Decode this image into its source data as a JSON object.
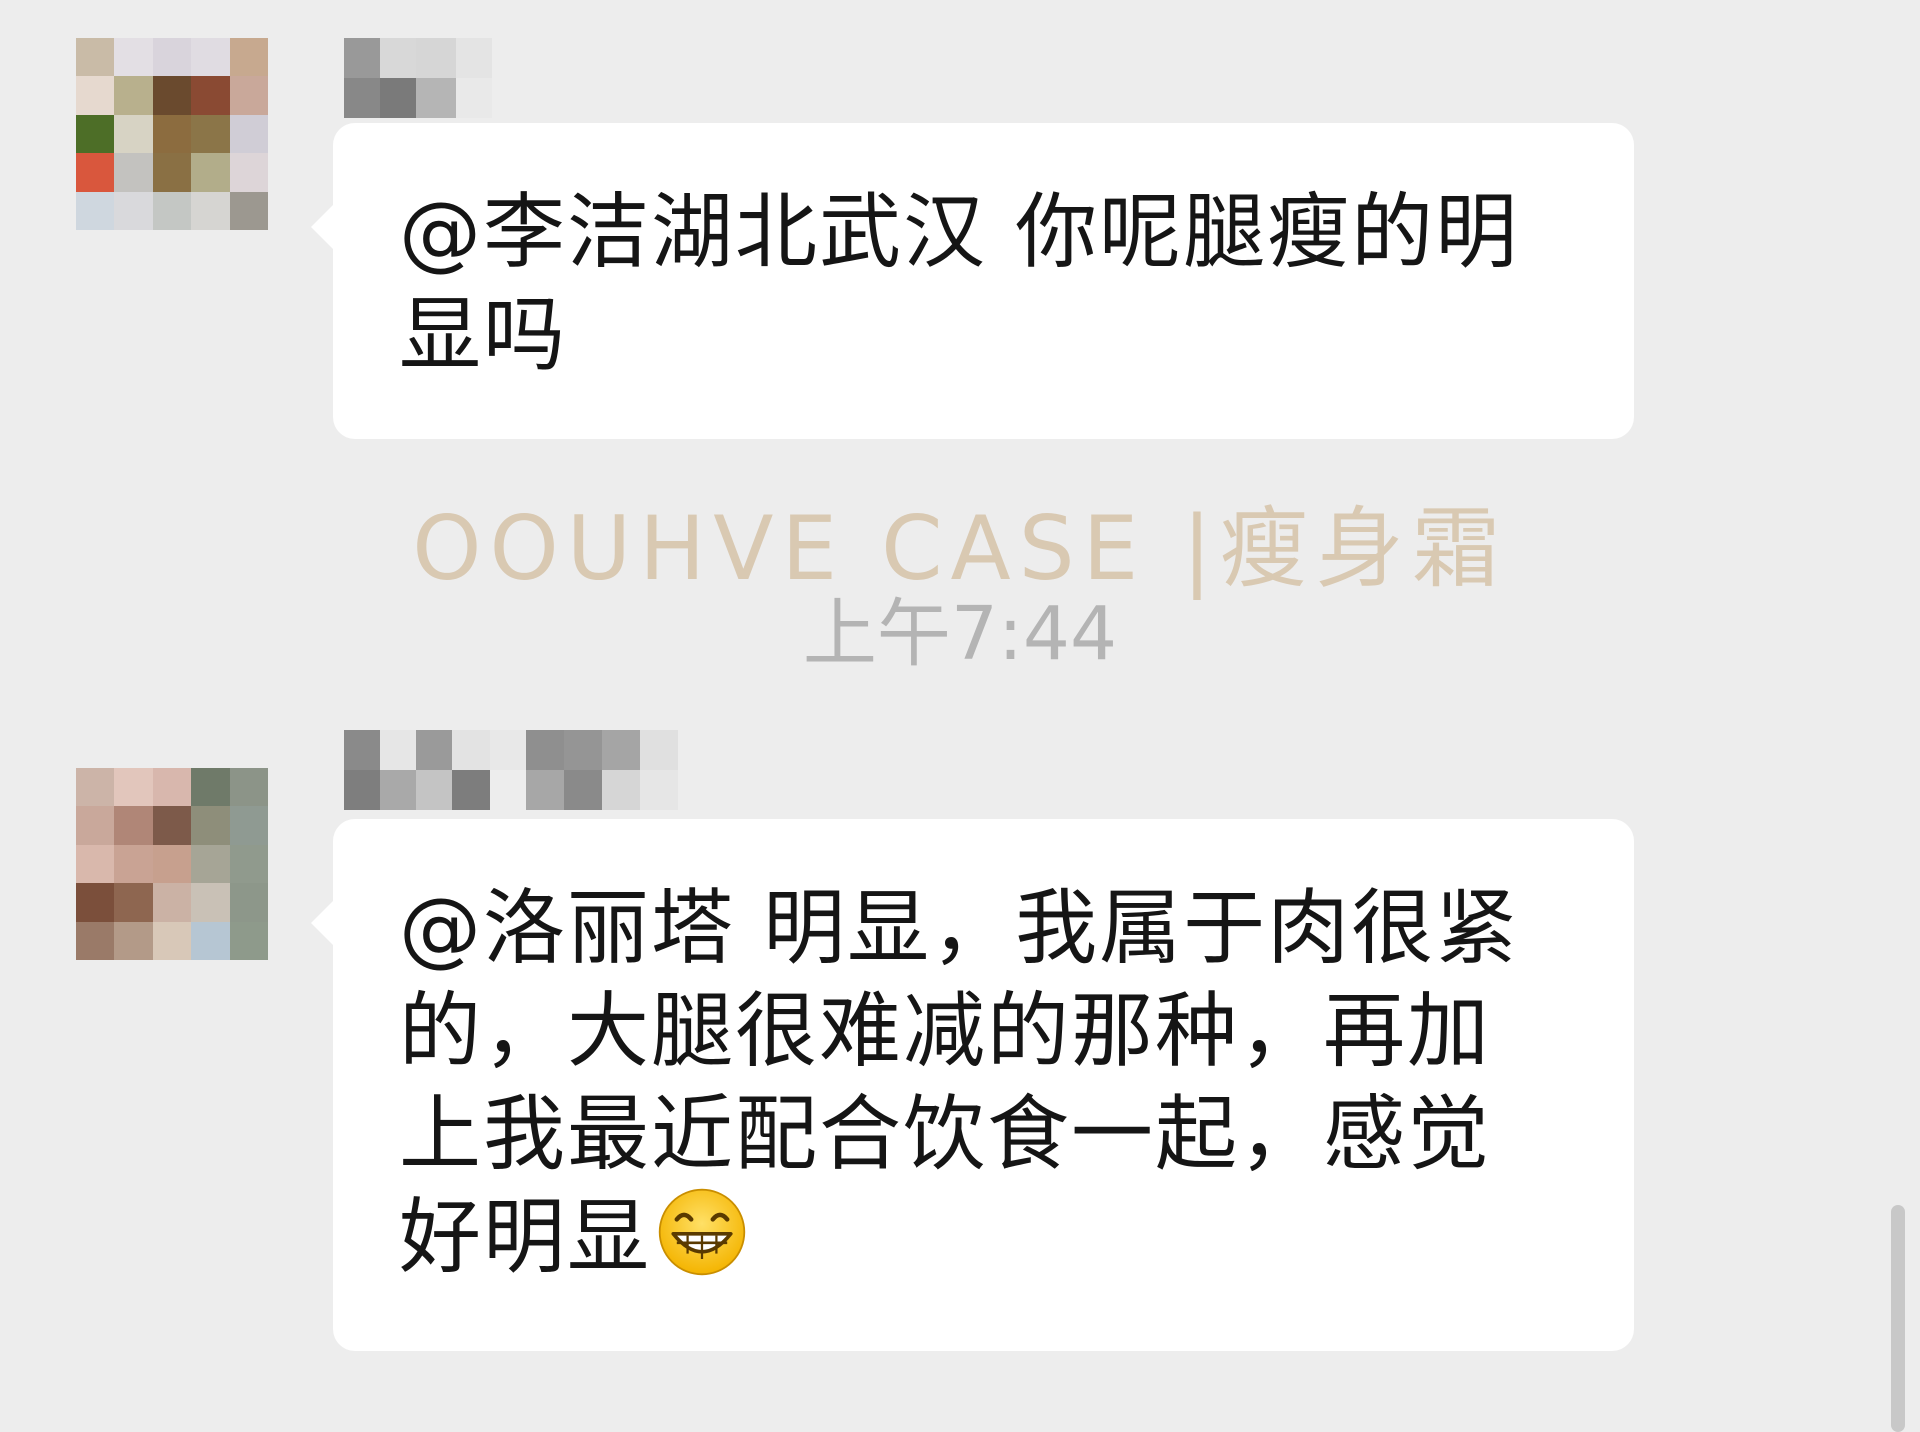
{
  "messages": [
    {
      "text": "@李洁湖北武汉 你呢腿瘦的明显吗"
    },
    {
      "text": "@洛丽塔 明显，我属于肉很紧的，大腿很难减的那种，再加上我最近配合饮食一起，感觉好明显",
      "emoji": "grinning-face-icon"
    }
  ],
  "watermark": "OOUHVE CASE |瘦身霜",
  "timestamp": "上午7:44",
  "colors": {
    "background": "#ededed",
    "bubble": "#ffffff",
    "text": "#151515",
    "timestamp": "#b4b4b4",
    "watermark": "#d9c9b2"
  }
}
